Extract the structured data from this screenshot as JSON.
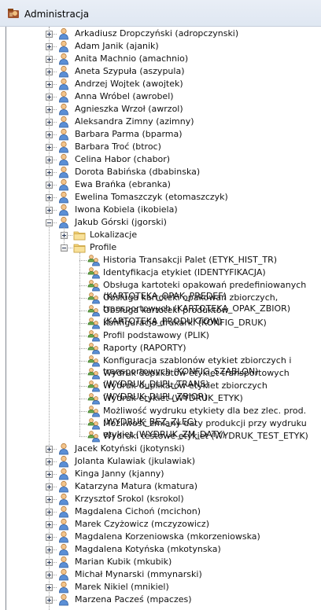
{
  "window": {
    "title": "Administracja"
  },
  "tree": {
    "users_before": [
      "Arkadiusz Dropczyński (adropczynski)",
      "Adam Janik (ajanik)",
      "Anita Machnio (amachnio)",
      "Aneta Szypuła (aszypula)",
      "Andrzej Wojtek (awojtek)",
      "Anna Wróbel (awrobel)",
      "Agnieszka Wrzoł (awrzol)",
      "Aleksandra Zimny (azimny)",
      "Barbara Parma (bparma)",
      "Barbara Troć (btroc)",
      "Celina Habor (chabor)",
      "Dorota Babińska (dbabinska)",
      "Ewa Brańka (ebranka)",
      "Ewelina Tomaszczyk (etomaszczyk)",
      "Iwona  Kobiela (ikobiela)"
    ],
    "expanded_user": {
      "label": "Jakub Górski (jgorski)",
      "lokalizacje": "Lokalizacje",
      "profile": "Profile",
      "profiles": [
        "Historia Transakcji Palet (ETYK_HIST_TR)",
        "Identyfikacja etykiet (IDENTYFIKACJA)",
        "Obsługa kartoteki opakowań predefiniowanych (KARTOTEKA_OPAK_PREDEF)",
        "Obsługa kartoteki opakowań zbiorczych, transportowych (KARTOTEKA_OPAK_ZBIOR)",
        "Obsługa kartoteki produktów (KARTOTEKA_PRODUKTOW)",
        "Konfiguracja drukarki (KONFIG_DRUK)",
        "Profil podstawowy (PLIK)",
        "Raporty (RAPORTY)",
        "Konfiguracja szablonów etykiet zbiorczych i transportowych (KONFIG_SZABLON)",
        "Wydruk duplikatów etykiet transportowych (WYDRUK_DUPL_TRANS)",
        "Wydruk duplikatów etykiet zbiorczych (WYDRUK_DUPL_ZBIOR)",
        "Wydruk etykiet (WYDRUK_ETYK)",
        "Możliwość wydruku etykiety dla bez zlec. prod. (WYDRUK_BEZ_ZLEC)",
        "Możliwość zmiany daty produkcji przy wydruku etykiet (WYDRUK_ZM_DATY)",
        "Wydruki testowe etykiet (WYDRUK_TEST_ETYK)"
      ]
    },
    "users_after": [
      "Jacek Kotyński (jkotynski)",
      "Jolanta Kulawiak (jkulawiak)",
      "Kinga Janny (kjanny)",
      "Katarzyna Matura (kmatura)",
      "Krzysztof Srokol (ksrokol)",
      "Magdalena Cichoń (mcichon)",
      "Marek Czyżowicz (mczyzowicz)",
      "Magdalena Korzeniowska (mkorzeniowska)",
      "Magdalena Kotyńska (mkotynska)",
      "Marian Kubik (mkubik)",
      "Michał Mynarski (mmynarski)",
      "Marek Nikiel (mnikiel)",
      "Marzena Pacześ (mpaczes)"
    ]
  }
}
